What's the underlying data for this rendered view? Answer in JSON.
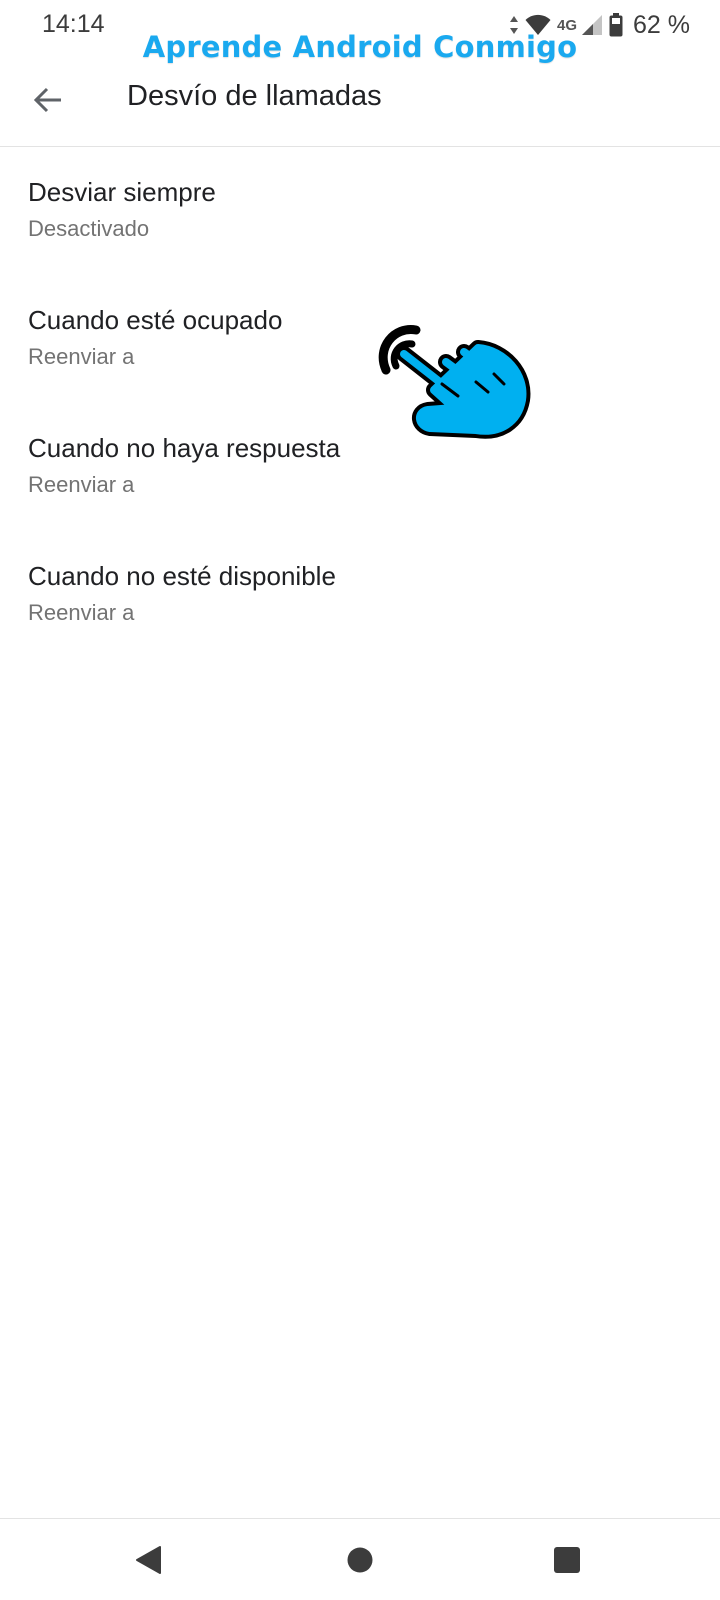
{
  "status_bar": {
    "time": "14:14",
    "network_label": "4G",
    "battery_text": "62 %"
  },
  "watermark": {
    "text": "Aprende Android Conmigo",
    "color": "#1aa9ef"
  },
  "app_bar": {
    "title": "Desvío de llamadas",
    "back_icon": "arrow-back-icon"
  },
  "settings": {
    "items": [
      {
        "title": "Desviar siempre",
        "summary": "Desactivado"
      },
      {
        "title": "Cuando esté ocupado",
        "summary": "Reenviar a"
      },
      {
        "title": "Cuando no haya respuesta",
        "summary": "Reenviar a"
      },
      {
        "title": "Cuando no esté disponible",
        "summary": "Reenviar a"
      }
    ]
  },
  "overlay": {
    "icon": "pointing-hand-icon",
    "color": "#00b0f0"
  },
  "nav_bar": {
    "buttons": [
      "back-triangle-icon",
      "home-circle-icon",
      "recents-square-icon"
    ]
  }
}
